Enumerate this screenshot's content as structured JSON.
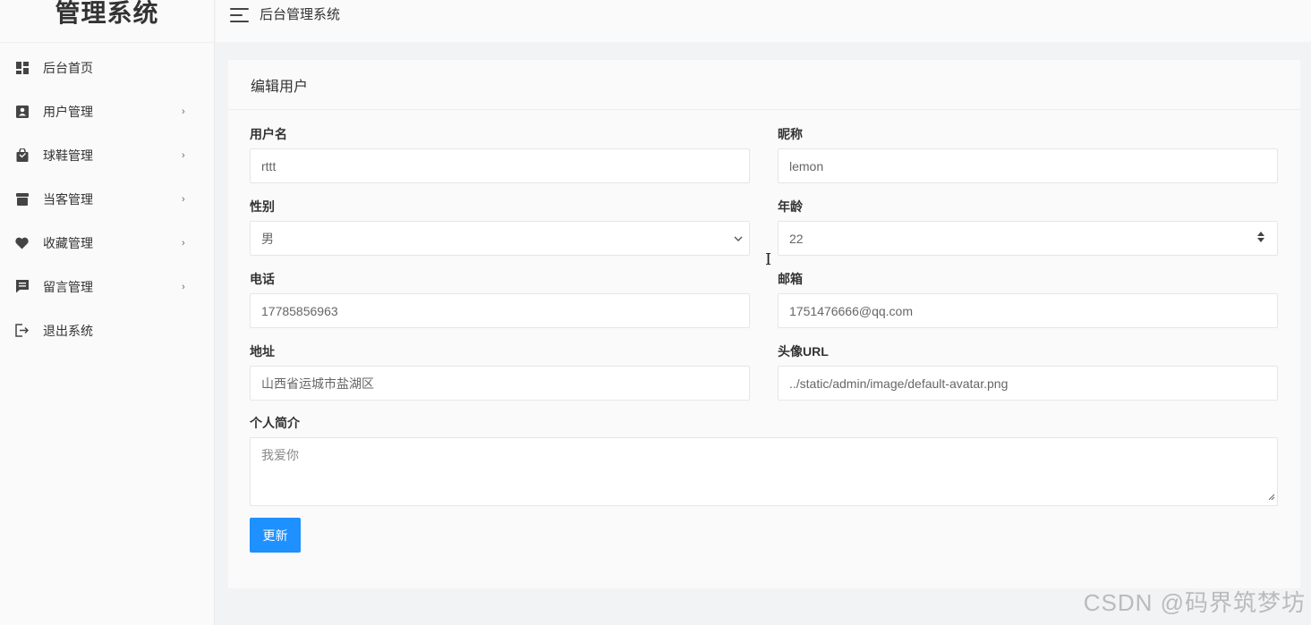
{
  "brand": {
    "title": "管理系统"
  },
  "topbar": {
    "title": "后台管理系统"
  },
  "sidebar": {
    "items": [
      {
        "label": "后台首页",
        "icon": "dashboard-icon",
        "has_children": false
      },
      {
        "label": "用户管理",
        "icon": "user-card-icon",
        "has_children": true
      },
      {
        "label": "球鞋管理",
        "icon": "shopping-bag-icon",
        "has_children": true
      },
      {
        "label": "当客管理",
        "icon": "archive-box-icon",
        "has_children": true
      },
      {
        "label": "收藏管理",
        "icon": "heart-icon",
        "has_children": true
      },
      {
        "label": "留言管理",
        "icon": "message-icon",
        "has_children": true
      },
      {
        "label": "退出系统",
        "icon": "logout-icon",
        "has_children": false
      }
    ]
  },
  "form": {
    "title": "编辑用户",
    "username": {
      "label": "用户名",
      "value": "rttt"
    },
    "nickname": {
      "label": "昵称",
      "value": "lemon"
    },
    "gender": {
      "label": "性别",
      "value": "男"
    },
    "age": {
      "label": "年龄",
      "value": "22"
    },
    "phone": {
      "label": "电话",
      "value": "17785856963"
    },
    "email": {
      "label": "邮箱",
      "value": "1751476666@qq.com"
    },
    "address": {
      "label": "地址",
      "value": "山西省运城市盐湖区"
    },
    "avatar": {
      "label": "头像URL",
      "value": "../static/admin/image/default-avatar.png"
    },
    "bio": {
      "label": "个人简介",
      "value": "我爱你"
    },
    "submit_label": "更新"
  },
  "watermark": "CSDN @码界筑梦坊",
  "colors": {
    "primary_button": "#1e90ff",
    "sidebar_bg": "#fafafa",
    "page_bg": "#f2f3f5"
  }
}
